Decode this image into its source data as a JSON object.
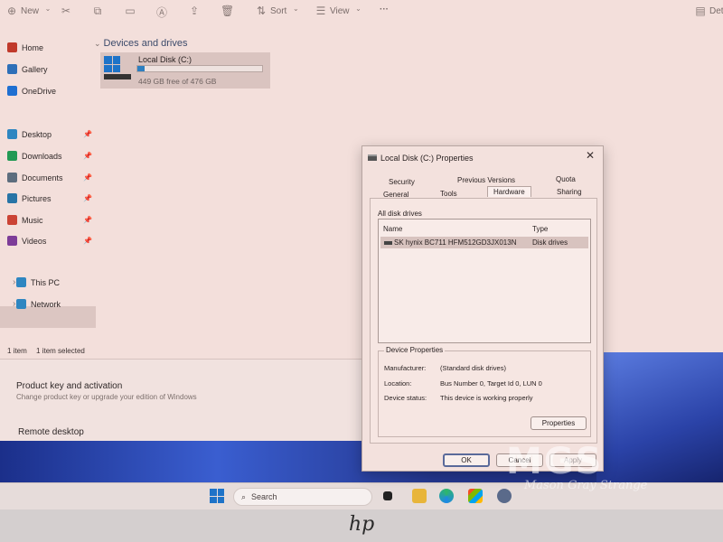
{
  "explorer": {
    "toolbar": {
      "new_label": "New",
      "sort_label": "Sort",
      "view_label": "View",
      "more_label": "···",
      "details_label": "Detai"
    },
    "sidebar": {
      "items": [
        {
          "label": "Home",
          "icon": "home-icon",
          "color": "#c0392b"
        },
        {
          "label": "Gallery",
          "icon": "gallery-icon",
          "color": "#2e6fb8"
        },
        {
          "label": "OneDrive",
          "icon": "onedrive-icon",
          "color": "#1f6fd1"
        },
        {
          "label": "Desktop",
          "icon": "desktop-icon",
          "color": "#2e86c1"
        },
        {
          "label": "Downloads",
          "icon": "download-icon",
          "color": "#229954"
        },
        {
          "label": "Documents",
          "icon": "documents-icon",
          "color": "#5d6d7e"
        },
        {
          "label": "Pictures",
          "icon": "pictures-icon",
          "color": "#2874a6"
        },
        {
          "label": "Music",
          "icon": "music-icon",
          "color": "#cb4335"
        },
        {
          "label": "Videos",
          "icon": "videos-icon",
          "color": "#7d3c98"
        },
        {
          "label": "This PC",
          "icon": "this-pc-icon",
          "color": "#2e86c1"
        },
        {
          "label": "Network",
          "icon": "network-icon",
          "color": "#2e86c1"
        }
      ]
    },
    "section_title": "Devices and drives",
    "drive": {
      "name": "Local Disk (C:)",
      "free_text": "449 GB free of 476 GB",
      "used_fraction": 0.06
    },
    "status": {
      "items": "1 item",
      "selected": "1 item selected"
    }
  },
  "settings": {
    "product_key_title": "Product key and activation",
    "product_key_sub": "Change product key or upgrade your edition of Windows",
    "remote_desktop": "Remote desktop"
  },
  "dialog": {
    "title": "Local Disk (C:) Properties",
    "tabs_row1": [
      "Security",
      "Previous Versions",
      "Quota"
    ],
    "tabs_row2": [
      "General",
      "Tools",
      "Hardware",
      "Sharing"
    ],
    "active_tab": "Hardware",
    "all_disk_drives_label": "All disk drives",
    "columns": {
      "name": "Name",
      "type": "Type"
    },
    "drives": [
      {
        "name": "SK hynix BC711 HFM512GD3JX013N",
        "type": "Disk drives"
      }
    ],
    "device_properties": {
      "label": "Device Properties",
      "manufacturer_label": "Manufacturer:",
      "manufacturer": "(Standard disk drives)",
      "location_label": "Location:",
      "location": "Bus Number 0, Target Id 0, LUN 0",
      "status_label": "Device status:",
      "status": "This device is working properly"
    },
    "properties_button": "Properties",
    "ok_button": "OK",
    "cancel_button": "Cancel",
    "apply_button": "Apply"
  },
  "taskbar": {
    "search_label": "Search"
  },
  "bezel": {
    "logo": "hp"
  },
  "watermark": {
    "mark": "MGS",
    "text": "Mason Gray Strange"
  }
}
